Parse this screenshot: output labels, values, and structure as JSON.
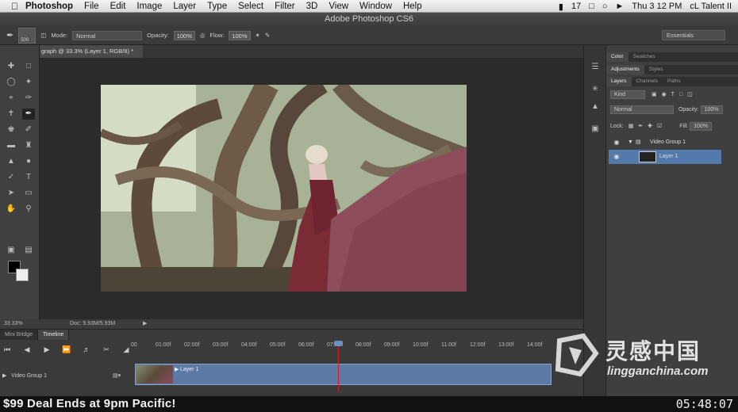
{
  "menubar": {
    "items": [
      "Photoshop",
      "File",
      "Edit",
      "Image",
      "Layer",
      "Type",
      "Select",
      "Filter",
      "3D",
      "View",
      "Window",
      "Help"
    ],
    "battery_count": "17",
    "clock": "Thu 3 12 PM",
    "user": "cL Talent II"
  },
  "window": {
    "title": "Adobe Photoshop CS6"
  },
  "options": {
    "brush_size": "500",
    "mode_label": "Mode:",
    "mode_value": "Normal",
    "opacity_label": "Opacity:",
    "opacity_value": "100%",
    "flow_label": "Flow:",
    "flow_value": "100%",
    "workspace": "Essentials"
  },
  "document": {
    "tab_title": "graph @ 33.3% (Layer 1, RGB/8) *",
    "zoom": "33.33%",
    "doc_size": "Doc: 5.93M/5.93M"
  },
  "timeline": {
    "tabs": [
      "Mini Bridge",
      "Timeline"
    ],
    "ruler": [
      "00",
      "01:00f",
      "02:00f",
      "03:00f",
      "04:00f",
      "05:00f",
      "06:00f",
      "07:00f",
      "08:00f",
      "09:00f",
      "10:00f",
      "11:00f",
      "12:00f",
      "13:00f",
      "14:00f"
    ],
    "track_name": "Video Group 1",
    "clip_label": "Layer 1"
  },
  "panels": {
    "top_tabs": [
      "Color",
      "Swatches"
    ],
    "mid_tabs": [
      "Adjustments",
      "Styles"
    ],
    "layer_tabs": [
      "Layers",
      "Channels",
      "Paths"
    ],
    "kind": "Kind",
    "blend_mode": "Normal",
    "opacity_label": "Opacity:",
    "opacity_value": "100%",
    "lock_label": "Lock:",
    "fill_label": "Fill:",
    "fill_value": "100%",
    "group_name": "Video Group 1",
    "layer_name": "Layer 1"
  },
  "promo": {
    "text": "$99 Deal Ends at 9pm Pacific!",
    "timecode": "05:48:07"
  },
  "watermark": {
    "brand": "灵感中国",
    "url": "lingganchina.com"
  }
}
